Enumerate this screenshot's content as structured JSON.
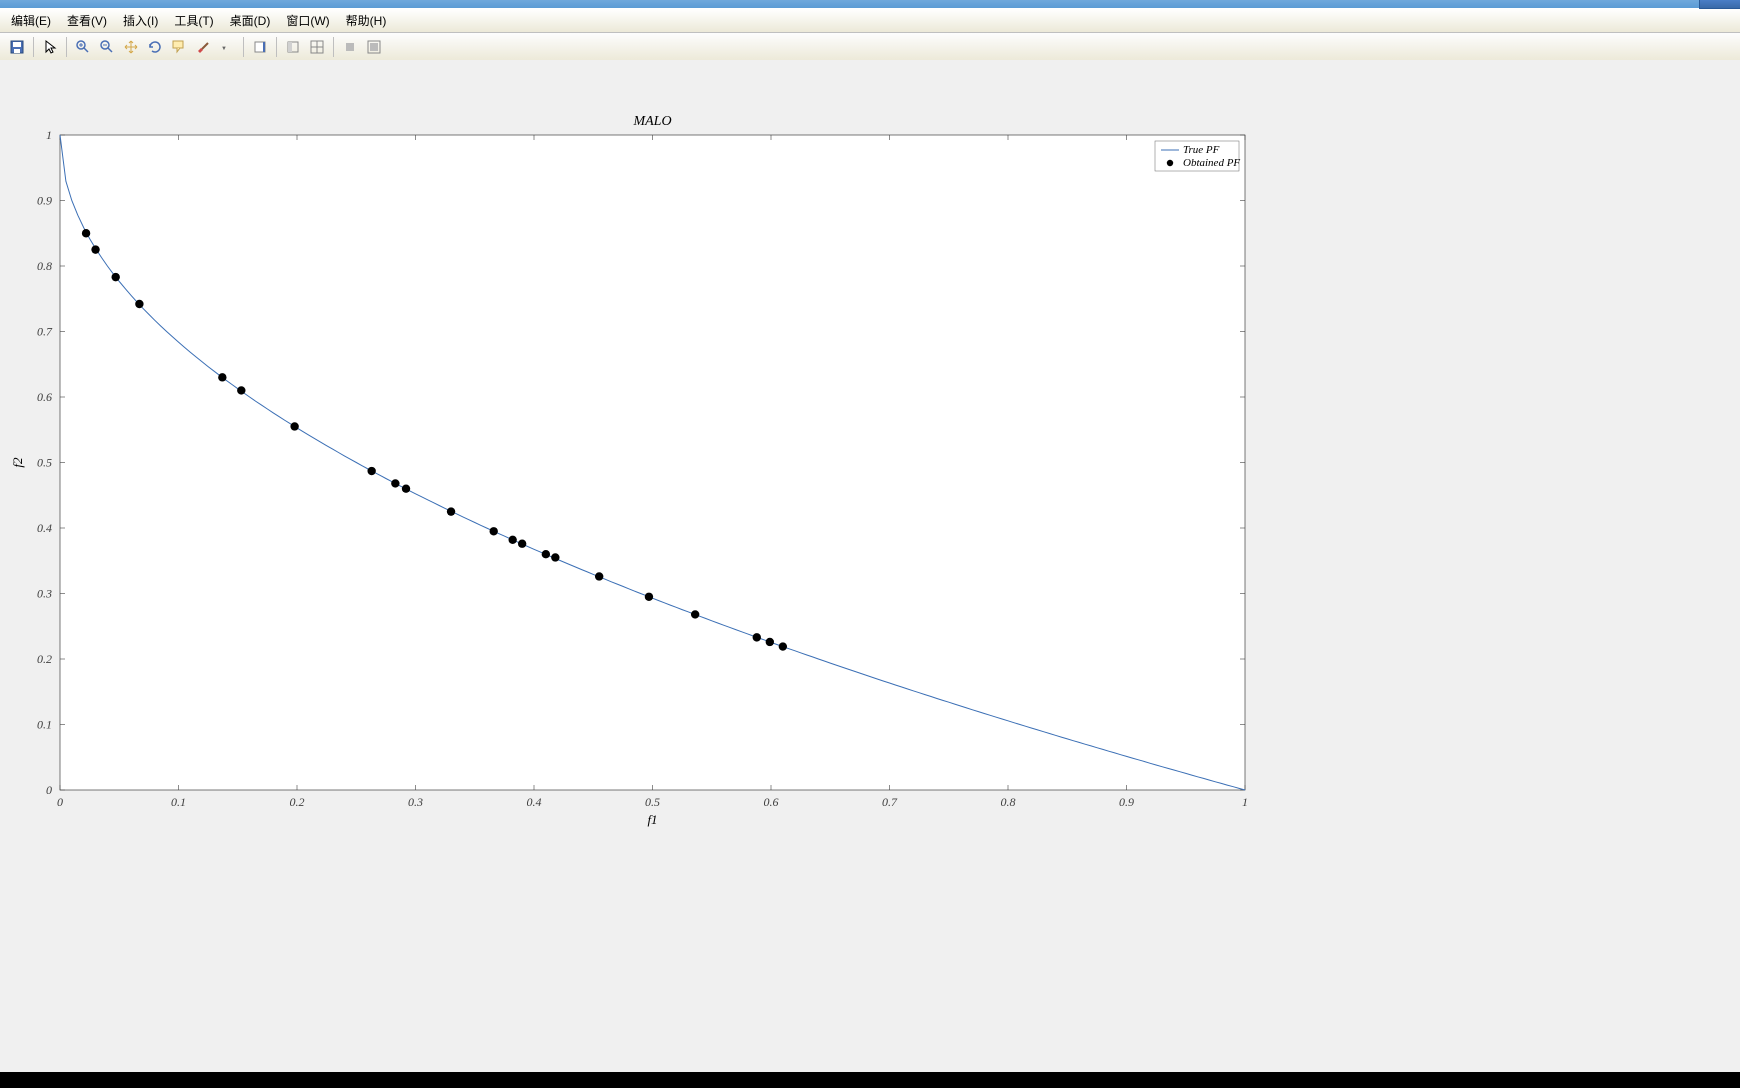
{
  "menu": {
    "edit": "编辑(E)",
    "view": "查看(V)",
    "insert": "插入(I)",
    "tools": "工具(T)",
    "desktop": "桌面(D)",
    "window": "窗口(W)",
    "help": "帮助(H)"
  },
  "chart_data": {
    "type": "line+scatter",
    "title": "MALO",
    "xlabel": "f1",
    "ylabel": "f2",
    "xlim": [
      0,
      1
    ],
    "ylim": [
      0,
      1
    ],
    "xticks": [
      0,
      0.1,
      0.2,
      0.3,
      0.4,
      0.5,
      0.6,
      0.7,
      0.8,
      0.9,
      1
    ],
    "yticks": [
      0,
      0.1,
      0.2,
      0.3,
      0.4,
      0.5,
      0.6,
      0.7,
      0.8,
      0.9,
      1
    ],
    "series": [
      {
        "name": "True PF",
        "type": "line",
        "color": "#3b6fb5",
        "note": "y = 1 - sqrt(x), sampled 0..1"
      },
      {
        "name": "Obtained PF",
        "type": "scatter",
        "color": "#000",
        "points": [
          [
            0.022,
            0.85
          ],
          [
            0.03,
            0.825
          ],
          [
            0.047,
            0.783
          ],
          [
            0.067,
            0.742
          ],
          [
            0.137,
            0.63
          ],
          [
            0.153,
            0.61
          ],
          [
            0.198,
            0.555
          ],
          [
            0.263,
            0.487
          ],
          [
            0.283,
            0.468
          ],
          [
            0.292,
            0.46
          ],
          [
            0.33,
            0.425
          ],
          [
            0.366,
            0.395
          ],
          [
            0.382,
            0.382
          ],
          [
            0.39,
            0.376
          ],
          [
            0.41,
            0.36
          ],
          [
            0.418,
            0.355
          ],
          [
            0.455,
            0.326
          ],
          [
            0.497,
            0.295
          ],
          [
            0.536,
            0.268
          ],
          [
            0.588,
            0.233
          ],
          [
            0.599,
            0.226
          ],
          [
            0.61,
            0.219
          ]
        ]
      }
    ],
    "legend": {
      "position": "top-right",
      "entries": [
        "True PF",
        "Obtained PF"
      ]
    }
  }
}
